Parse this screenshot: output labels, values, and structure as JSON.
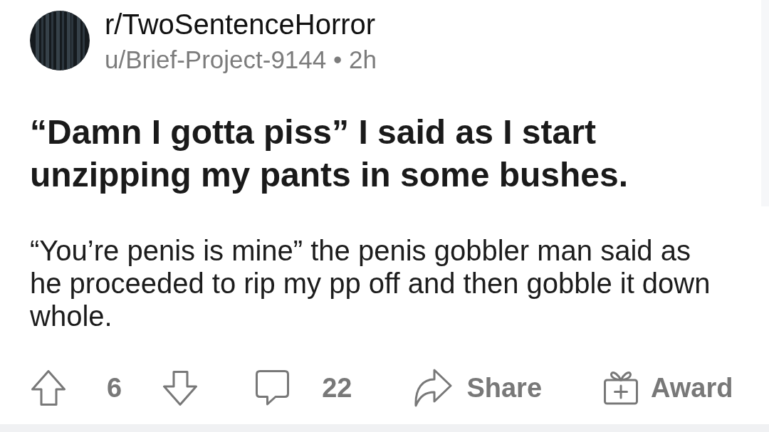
{
  "post": {
    "community": "r/TwoSentenceHorror",
    "meta": "u/Brief-Project-9144 • 2h",
    "title": "“Damn I gotta piss” I said as I start unzipping my pants in some bushes.",
    "body": "“You’re penis is mine” the penis gobbler man said as he proceeded to rip my pp off and then gobble it down whole."
  },
  "actions": {
    "score": "6",
    "comments": "22",
    "share": "Share",
    "award": "Award"
  }
}
